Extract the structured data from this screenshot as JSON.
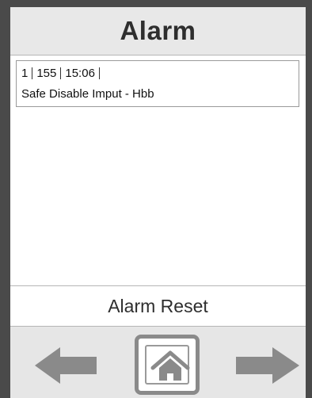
{
  "header": {
    "title": "Alarm"
  },
  "alarm_list": {
    "entries": [
      {
        "number": "1",
        "code": "155",
        "time": "15:06",
        "description": "Safe Disable Imput - Hbb"
      }
    ]
  },
  "reset_button": {
    "label": "Alarm Reset"
  },
  "navigation": {
    "back_icon": "arrow-left-icon",
    "home_icon": "home-icon",
    "forward_icon": "arrow-right-icon"
  },
  "colors": {
    "frame": "#4a4a4a",
    "header_bg": "#e8e8e8",
    "nav_bg": "#e6e6e6",
    "arrow": "#8a8a8a"
  }
}
